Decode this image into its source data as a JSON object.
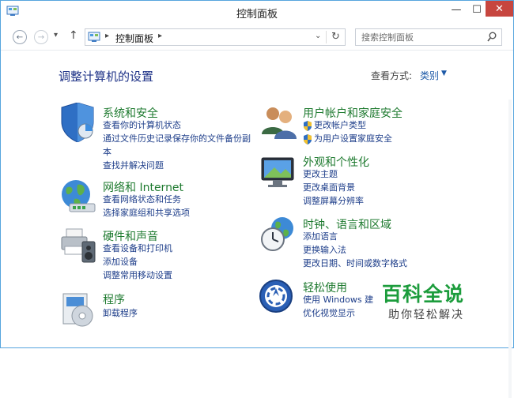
{
  "window": {
    "title": "控制面板",
    "min_glyph": "—",
    "max_glyph": "☐",
    "close_glyph": "✕"
  },
  "nav": {
    "back_glyph": "←",
    "forward_glyph": "→",
    "recent_glyph": "▾",
    "up_glyph": "↑"
  },
  "address": {
    "path": "控制面板",
    "chevron": "▸",
    "dropdown_glyph": "⌄",
    "refresh_glyph": "↻"
  },
  "search": {
    "placeholder": "搜索控制面板"
  },
  "main": {
    "heading": "调整计算机的设置",
    "view_by_label": "查看方式:",
    "view_by_value": "类别",
    "view_by_arrow": "▼"
  },
  "categories_left": [
    {
      "title": "系统和安全",
      "icon": "shield-chart-icon",
      "links": [
        "查看你的计算机状态",
        "通过文件历史记录保存你的文件备份副",
        "本",
        "查找并解决问题"
      ]
    },
    {
      "title": "网络和 Internet",
      "icon": "globe-network-icon",
      "links": [
        "查看网络状态和任务",
        "选择家庭组和共享选项"
      ]
    },
    {
      "title": "硬件和声音",
      "icon": "printer-speaker-icon",
      "links": [
        "查看设备和打印机",
        "添加设备",
        "调整常用移动设置"
      ]
    },
    {
      "title": "程序",
      "icon": "programs-disc-icon",
      "links": [
        "卸载程序"
      ]
    }
  ],
  "categories_right": [
    {
      "title": "用户帐户和家庭安全",
      "icon": "users-icon",
      "links": [
        "更改帐户类型",
        "为用户设置家庭安全"
      ]
    },
    {
      "title": "外观和个性化",
      "icon": "monitor-appearance-icon",
      "links": [
        "更改主题",
        "更改桌面背景",
        "调整屏幕分辨率"
      ]
    },
    {
      "title": "时钟、语言和区域",
      "icon": "clock-globe-icon",
      "links": [
        "添加语言",
        "更换输入法",
        "更改日期、时间或数字格式"
      ]
    },
    {
      "title": "轻松使用",
      "icon": "ease-of-access-icon",
      "links": [
        "使用 Windows 建",
        "优化视觉显示"
      ]
    }
  ],
  "watermark": {
    "main": "百科全说",
    "sub": "助你轻松解决"
  },
  "colors": {
    "heading": "#1e3287",
    "category_title": "#1e7a2f",
    "link": "#1e3e8a",
    "close_button": "#c7463f",
    "watermark": "#1c9c3c"
  }
}
